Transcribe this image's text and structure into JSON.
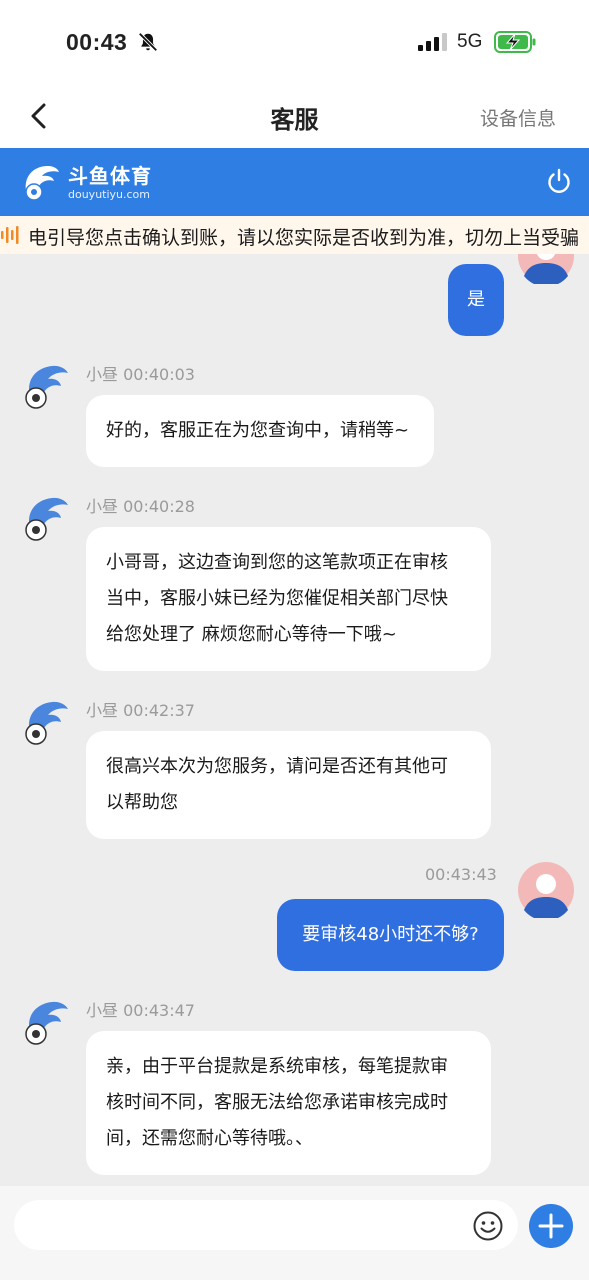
{
  "status_bar": {
    "time": "00:43",
    "network": "5G"
  },
  "nav": {
    "title": "客服",
    "right_label": "设备信息"
  },
  "brand": {
    "name": "斗鱼体育",
    "url": "douyutiyu.com"
  },
  "marquee": {
    "text": "电引导您点击确认到账，请以您实际是否收到为准，切勿上当受骗"
  },
  "messages": [
    {
      "sender": "me",
      "text": "是"
    },
    {
      "sender": "agent",
      "name": "小昼",
      "time": "00:40:03",
      "lines": [
        "好的，客服正在为您查询中，请稍等~"
      ]
    },
    {
      "sender": "agent",
      "name": "小昼",
      "time": "00:40:28",
      "lines": [
        "小哥哥，这边查询到您的这笔款项正在审核",
        "当中，客服小妹已经为您催促相关部门尽快",
        "给您处理了 麻烦您耐心等待一下哦~"
      ]
    },
    {
      "sender": "agent",
      "name": "小昼",
      "time": "00:42:37",
      "lines": [
        "很高兴本次为您服务，请问是否还有其他可",
        "以帮助您"
      ]
    },
    {
      "sender": "me",
      "time": "00:43:43",
      "text": "要审核48小时还不够?"
    },
    {
      "sender": "agent",
      "name": "小昼",
      "time": "00:43:47",
      "lines": [
        "亲，由于平台提款是系统审核，每笔提款审",
        "核时间不同，客服无法给您承诺审核完成时",
        "间，还需您耐心等待哦。、"
      ]
    }
  ],
  "input": {
    "placeholder": ""
  },
  "colors": {
    "brand_blue": "#2f7ee3",
    "my_bubble": "#2f6fe0",
    "chat_bg": "#ededed",
    "marquee_bg": "#fff6ec"
  }
}
